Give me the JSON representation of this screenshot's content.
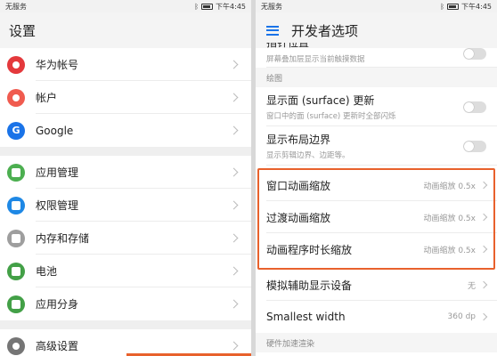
{
  "status": {
    "carrier": "无服务",
    "time": "下午4:45",
    "battery": "80"
  },
  "left": {
    "title": "设置",
    "groups": [
      [
        {
          "label": "华为帐号"
        },
        {
          "label": "帐户"
        },
        {
          "label": "Google"
        }
      ],
      [
        {
          "label": "应用管理"
        },
        {
          "label": "权限管理"
        },
        {
          "label": "内存和存储"
        },
        {
          "label": "电池"
        },
        {
          "label": "应用分身"
        }
      ],
      [
        {
          "label": "高级设置"
        }
      ]
    ]
  },
  "right": {
    "title": "开发者选项",
    "top_partial": {
      "title": "指针位置",
      "sub": "屏幕叠加层显示当前触摸数据"
    },
    "section_draw": "绘图",
    "surface": {
      "title": "显示面 (surface) 更新",
      "sub": "窗口中的面 (surface) 更新时全部闪烁"
    },
    "layout": {
      "title": "显示布局边界",
      "sub": "显示剪辑边界、边距等。"
    },
    "anim": [
      {
        "title": "窗口动画缩放",
        "value": "动画缩放 0.5x"
      },
      {
        "title": "过渡动画缩放",
        "value": "动画缩放 0.5x"
      },
      {
        "title": "动画程序时长缩放",
        "value": "动画缩放 0.5x"
      }
    ],
    "secondary": {
      "title": "模拟辅助显示设备",
      "value": "无"
    },
    "smallest": {
      "title": "Smallest width",
      "value": "360 dp"
    },
    "section_hw": "硬件加速渲染"
  },
  "colors": {
    "accent": "#e8612c",
    "blue": "#1a73e8"
  }
}
